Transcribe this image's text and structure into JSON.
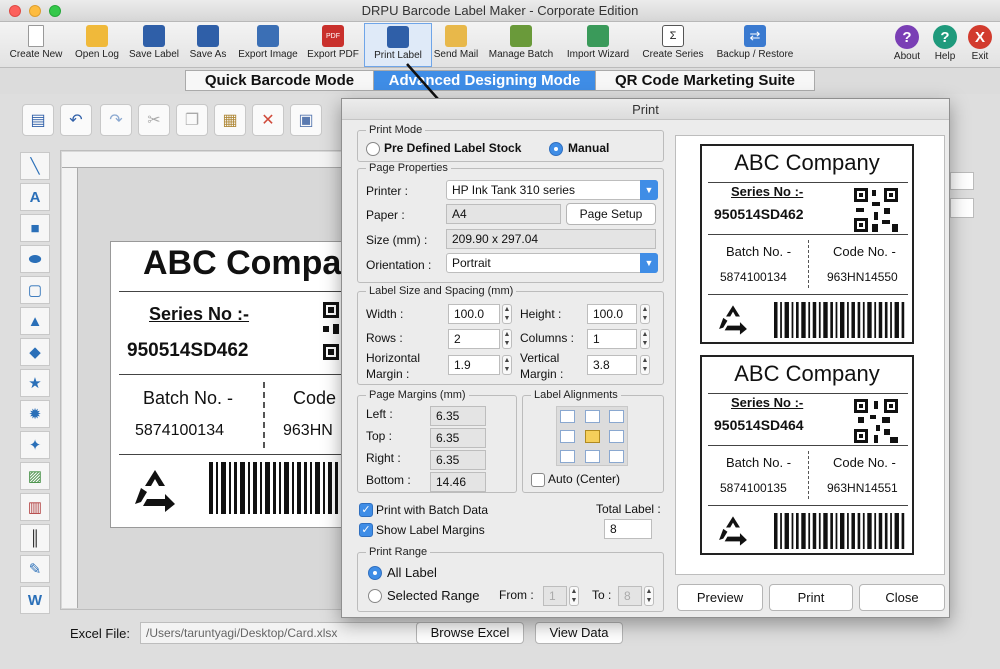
{
  "app": {
    "title": "DRPU Barcode Label Maker - Corporate Edition"
  },
  "toolbar": {
    "items": [
      {
        "label": "Create New",
        "icon": "new-document-icon"
      },
      {
        "label": "Open Log",
        "icon": "open-folder-icon"
      },
      {
        "label": "Save Label",
        "icon": "save-icon"
      },
      {
        "label": "Save As",
        "icon": "save-as-icon"
      },
      {
        "label": "Export Image",
        "icon": "export-image-icon"
      },
      {
        "label": "Export PDF",
        "icon": "pdf-icon"
      },
      {
        "label": "Print Label",
        "icon": "printer-icon"
      },
      {
        "label": "Send Mail",
        "icon": "mail-icon"
      },
      {
        "label": "Manage Batch",
        "icon": "batch-icon"
      },
      {
        "label": "Import Wizard",
        "icon": "import-wizard-icon"
      },
      {
        "label": "Create Series",
        "icon": "series-icon"
      },
      {
        "label": "Backup / Restore",
        "icon": "backup-icon"
      }
    ],
    "right": [
      {
        "label": "About",
        "icon": "about-icon",
        "glyph": "?",
        "color": "#7a3fb5"
      },
      {
        "label": "Help",
        "icon": "help-icon",
        "glyph": "?",
        "color": "#1f9a7c"
      },
      {
        "label": "Exit",
        "icon": "exit-icon",
        "glyph": "X",
        "color": "#d23b2e"
      }
    ]
  },
  "modes": [
    {
      "label": "Quick Barcode Mode",
      "active": false
    },
    {
      "label": "Advanced Designing Mode",
      "active": true
    },
    {
      "label": "QR Code Marketing Suite",
      "active": false
    }
  ],
  "design_label": {
    "company": "ABC Compan",
    "series_label": "Series No :-",
    "series_value": "950514SD462",
    "batch_label": "Batch No. -",
    "batch_value": "5874100134",
    "code_label": "Code",
    "code_value": "963HN"
  },
  "excel": {
    "label": "Excel File:",
    "path": "/Users/taruntyagi/Desktop/Card.xlsx",
    "browse_label": "Browse Excel",
    "view_label": "View Data"
  },
  "print_dialog": {
    "title": "Print",
    "print_mode": {
      "legend": "Print Mode",
      "option_predefined": "Pre Defined Label Stock",
      "option_manual": "Manual",
      "selected": "Manual"
    },
    "page_properties": {
      "legend": "Page Properties",
      "printer_label": "Printer :",
      "printer_value": "HP Ink Tank 310 series",
      "paper_label": "Paper :",
      "paper_value": "A4",
      "page_setup_label": "Page Setup",
      "size_label": "Size (mm) :",
      "size_value": "209.90 x 297.04",
      "orientation_label": "Orientation :",
      "orientation_value": "Portrait"
    },
    "label_size": {
      "legend": "Label Size and Spacing (mm)",
      "width_label": "Width :",
      "width_value": "100.0",
      "height_label": "Height :",
      "height_value": "100.0",
      "rows_label": "Rows :",
      "rows_value": "2",
      "columns_label": "Columns :",
      "columns_value": "1",
      "hmargin_label_1": "Horizontal",
      "hmargin_label_2": "Margin :",
      "hmargin_value": "1.9",
      "vmargin_label_1": "Vertical",
      "vmargin_label_2": "Margin :",
      "vmargin_value": "3.8"
    },
    "page_margins": {
      "legend": "Page Margins (mm)",
      "left_label": "Left :",
      "left_value": "6.35",
      "top_label": "Top :",
      "top_value": "6.35",
      "right_label": "Right :",
      "right_value": "6.35",
      "bottom_label": "Bottom :",
      "bottom_value": "14.46"
    },
    "label_alignments": {
      "legend": "Label Alignments",
      "auto_center_label": "Auto (Center)",
      "auto_center_checked": false
    },
    "print_with_batch": {
      "label": "Print with Batch Data",
      "checked": true
    },
    "show_margins": {
      "label": "Show Label Margins",
      "checked": true
    },
    "total_label": {
      "label": "Total Label :",
      "value": "8"
    },
    "print_range": {
      "legend": "Print Range",
      "all_label": "All Label",
      "selected_range_label": "Selected Range",
      "selected": "All Label",
      "from_label": "From :",
      "from_value": "1",
      "to_label": "To :",
      "to_value": "8"
    },
    "buttons": {
      "preview": "Preview",
      "print": "Print",
      "close": "Close"
    },
    "preview_cards": [
      {
        "company": "ABC Company",
        "series_label": "Series No :-",
        "series_value": "950514SD462",
        "batch_label": "Batch No. -",
        "batch_value": "5874100134",
        "code_label": "Code No. -",
        "code_value": "963HN14550"
      },
      {
        "company": "ABC Company",
        "series_label": "Series No :-",
        "series_value": "950514SD464",
        "batch_label": "Batch No. -",
        "batch_value": "5874100135",
        "code_label": "Code No. -",
        "code_value": "963HN14551"
      }
    ]
  },
  "colors": {
    "accent": "#3f8de6"
  }
}
